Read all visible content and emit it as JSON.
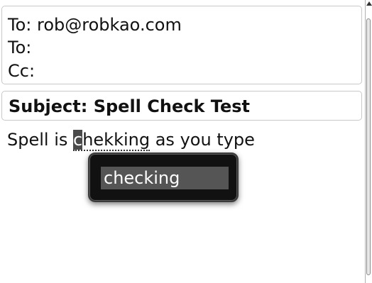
{
  "header": {
    "to_primary": "To: rob@robkao.com",
    "to_secondary": "To:",
    "cc": "Cc:"
  },
  "subject": {
    "label": "Subject: Spell Check Test"
  },
  "body": {
    "prefix": "Spell is ",
    "cursor_char": "c",
    "misspelled_rest": "hekking",
    "suffix": " as you type"
  },
  "spellcheck_popup": {
    "suggestion": "checking"
  },
  "icons": {
    "scroll_up": "arrow-up-icon"
  }
}
